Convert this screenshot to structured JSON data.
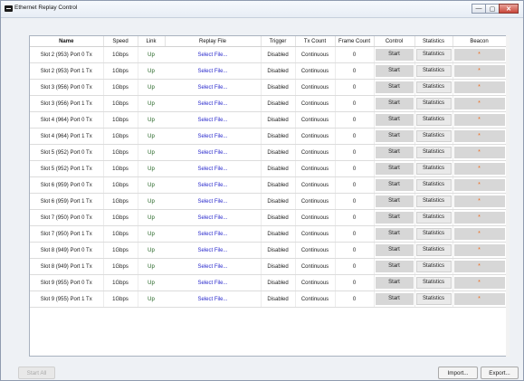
{
  "window": {
    "title": "Ethernet Replay Control",
    "minimize": "—",
    "maximize": "▢",
    "close": "✕"
  },
  "columns": {
    "name": "Name",
    "speed": "Speed",
    "link": "Link",
    "replay_file": "Replay File",
    "trigger": "Trigger",
    "tx_count": "Tx Count",
    "frame_count": "Frame Count",
    "control": "Control",
    "statistics": "Statistics",
    "beacon": "Beacon"
  },
  "rows": [
    {
      "num": "1",
      "name": "Slot 2 (953) Port 0 Tx",
      "speed": "1Gbps",
      "link": "Up",
      "file": "Select File...",
      "trigger": "Disabled",
      "tx_count": "Continuous",
      "frame_count": "0",
      "control": "Start",
      "stats": "Statistics",
      "beacon": "*"
    },
    {
      "num": "2",
      "name": "Slot 2 (953) Port 1 Tx",
      "speed": "1Gbps",
      "link": "Up",
      "file": "Select File...",
      "trigger": "Disabled",
      "tx_count": "Continuous",
      "frame_count": "0",
      "control": "Start",
      "stats": "Statistics",
      "beacon": "*"
    },
    {
      "num": "3",
      "name": "Slot 3 (956) Port 0 Tx",
      "speed": "1Gbps",
      "link": "Up",
      "file": "Select File...",
      "trigger": "Disabled",
      "tx_count": "Continuous",
      "frame_count": "0",
      "control": "Start",
      "stats": "Statistics",
      "beacon": "*"
    },
    {
      "num": "4",
      "name": "Slot 3 (956) Port 1 Tx",
      "speed": "1Gbps",
      "link": "Up",
      "file": "Select File...",
      "trigger": "Disabled",
      "tx_count": "Continuous",
      "frame_count": "0",
      "control": "Start",
      "stats": "Statistics",
      "beacon": "*"
    },
    {
      "num": "5",
      "name": "Slot 4 (964) Port 0 Tx",
      "speed": "1Gbps",
      "link": "Up",
      "file": "Select File...",
      "trigger": "Disabled",
      "tx_count": "Continuous",
      "frame_count": "0",
      "control": "Start",
      "stats": "Statistics",
      "beacon": "*"
    },
    {
      "num": "6",
      "name": "Slot 4 (964) Port 1 Tx",
      "speed": "1Gbps",
      "link": "Up",
      "file": "Select File...",
      "trigger": "Disabled",
      "tx_count": "Continuous",
      "frame_count": "0",
      "control": "Start",
      "stats": "Statistics",
      "beacon": "*"
    },
    {
      "num": "7",
      "name": "Slot 5 (952) Port 0 Tx",
      "speed": "1Gbps",
      "link": "Up",
      "file": "Select File...",
      "trigger": "Disabled",
      "tx_count": "Continuous",
      "frame_count": "0",
      "control": "Start",
      "stats": "Statistics",
      "beacon": "*"
    },
    {
      "num": "8",
      "name": "Slot 5 (952) Port 1 Tx",
      "speed": "1Gbps",
      "link": "Up",
      "file": "Select File...",
      "trigger": "Disabled",
      "tx_count": "Continuous",
      "frame_count": "0",
      "control": "Start",
      "stats": "Statistics",
      "beacon": "*"
    },
    {
      "num": "9",
      "name": "Slot 6 (959) Port 0 Tx",
      "speed": "1Gbps",
      "link": "Up",
      "file": "Select File...",
      "trigger": "Disabled",
      "tx_count": "Continuous",
      "frame_count": "0",
      "control": "Start",
      "stats": "Statistics",
      "beacon": "*"
    },
    {
      "num": "10",
      "name": "Slot 6 (959) Port 1 Tx",
      "speed": "1Gbps",
      "link": "Up",
      "file": "Select File...",
      "trigger": "Disabled",
      "tx_count": "Continuous",
      "frame_count": "0",
      "control": "Start",
      "stats": "Statistics",
      "beacon": "*"
    },
    {
      "num": "11",
      "name": "Slot 7 (950) Port 0 Tx",
      "speed": "1Gbps",
      "link": "Up",
      "file": "Select File...",
      "trigger": "Disabled",
      "tx_count": "Continuous",
      "frame_count": "0",
      "control": "Start",
      "stats": "Statistics",
      "beacon": "*"
    },
    {
      "num": "12",
      "name": "Slot 7 (950) Port 1 Tx",
      "speed": "1Gbps",
      "link": "Up",
      "file": "Select File...",
      "trigger": "Disabled",
      "tx_count": "Continuous",
      "frame_count": "0",
      "control": "Start",
      "stats": "Statistics",
      "beacon": "*"
    },
    {
      "num": "13",
      "name": "Slot 8 (949) Port 0 Tx",
      "speed": "1Gbps",
      "link": "Up",
      "file": "Select File...",
      "trigger": "Disabled",
      "tx_count": "Continuous",
      "frame_count": "0",
      "control": "Start",
      "stats": "Statistics",
      "beacon": "*"
    },
    {
      "num": "14",
      "name": "Slot 8 (949) Port 1 Tx",
      "speed": "1Gbps",
      "link": "Up",
      "file": "Select File...",
      "trigger": "Disabled",
      "tx_count": "Continuous",
      "frame_count": "0",
      "control": "Start",
      "stats": "Statistics",
      "beacon": "*"
    },
    {
      "num": "15",
      "name": "Slot 9 (955) Port 0 Tx",
      "speed": "1Gbps",
      "link": "Up",
      "file": "Select File...",
      "trigger": "Disabled",
      "tx_count": "Continuous",
      "frame_count": "0",
      "control": "Start",
      "stats": "Statistics",
      "beacon": "*"
    },
    {
      "num": "16",
      "name": "Slot 9 (955) Port 1 Tx",
      "speed": "1Gbps",
      "link": "Up",
      "file": "Select File...",
      "trigger": "Disabled",
      "tx_count": "Continuous",
      "frame_count": "0",
      "control": "Start",
      "stats": "Statistics",
      "beacon": "*"
    }
  ],
  "buttons": {
    "start_all": "Start All",
    "import": "Import...",
    "export": "Export..."
  },
  "colors": {
    "link_up": "#22ee22",
    "file_link": "#2a2acc",
    "beacon": "#f06a1a"
  }
}
